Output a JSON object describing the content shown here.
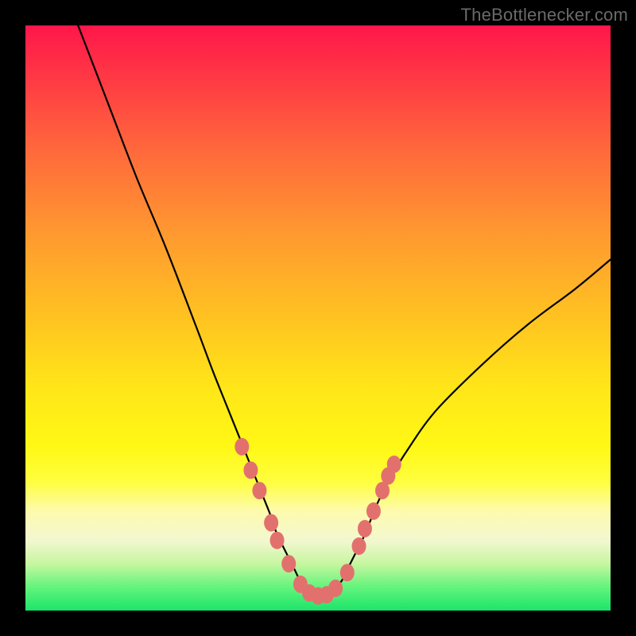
{
  "watermark": "TheBottlenecker.com",
  "chart_data": {
    "type": "line",
    "title": "",
    "xlabel": "",
    "ylabel": "",
    "xlim": [
      0,
      100
    ],
    "ylim": [
      0,
      100
    ],
    "series": [
      {
        "name": "bottleneck-curve",
        "x": [
          9,
          14,
          19,
          24,
          29,
          32,
          34,
          36,
          38,
          40,
          42,
          43,
          44,
          45,
          46,
          47,
          48,
          49,
          50,
          51,
          52,
          53,
          54,
          55,
          56,
          58,
          60,
          62,
          65,
          70,
          78,
          86,
          94,
          100
        ],
        "y": [
          100,
          87,
          74,
          62,
          49,
          41,
          36,
          31,
          26,
          21,
          16,
          13,
          11,
          9,
          7,
          5,
          4,
          3,
          2.5,
          2.5,
          3,
          4,
          5,
          7,
          9,
          13,
          18,
          22,
          27,
          34,
          42,
          49,
          55,
          60
        ]
      }
    ],
    "markers": {
      "name": "highlight-points",
      "points": [
        {
          "x": 37,
          "y": 28
        },
        {
          "x": 38.5,
          "y": 24
        },
        {
          "x": 40,
          "y": 20.5
        },
        {
          "x": 42,
          "y": 15
        },
        {
          "x": 43,
          "y": 12
        },
        {
          "x": 45,
          "y": 8
        },
        {
          "x": 47,
          "y": 4.5
        },
        {
          "x": 48.5,
          "y": 3
        },
        {
          "x": 50,
          "y": 2.5
        },
        {
          "x": 51.5,
          "y": 2.7
        },
        {
          "x": 53,
          "y": 3.8
        },
        {
          "x": 55,
          "y": 6.5
        },
        {
          "x": 57,
          "y": 11
        },
        {
          "x": 58,
          "y": 14
        },
        {
          "x": 59.5,
          "y": 17
        },
        {
          "x": 61,
          "y": 20.5
        },
        {
          "x": 62,
          "y": 23
        },
        {
          "x": 63,
          "y": 25
        }
      ]
    },
    "gradient_stops": [
      {
        "pos": 0,
        "color": "#ff164a"
      },
      {
        "pos": 50,
        "color": "#ffc321"
      },
      {
        "pos": 78,
        "color": "#fffe3f"
      },
      {
        "pos": 100,
        "color": "#1ce46a"
      }
    ]
  }
}
